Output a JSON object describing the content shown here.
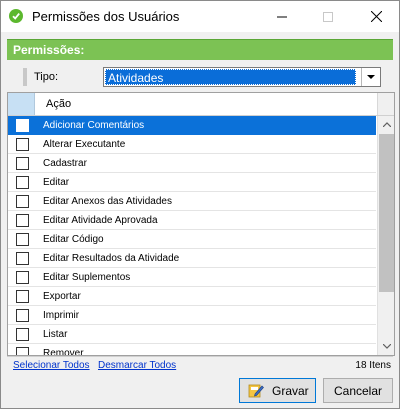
{
  "window": {
    "title": "Permissões dos Usuários",
    "icon": "app-check-icon"
  },
  "panel": {
    "header": "Permissões:"
  },
  "tipo": {
    "label": "Tipo:",
    "value": "Atividades"
  },
  "grid": {
    "column_header": "Ação",
    "rows": [
      {
        "label": "Adicionar Comentários",
        "checked": false,
        "selected": true
      },
      {
        "label": "Alterar Executante",
        "checked": false,
        "selected": false
      },
      {
        "label": "Cadastrar",
        "checked": false,
        "selected": false
      },
      {
        "label": "Editar",
        "checked": false,
        "selected": false
      },
      {
        "label": "Editar Anexos das Atividades",
        "checked": false,
        "selected": false
      },
      {
        "label": "Editar Atividade Aprovada",
        "checked": false,
        "selected": false
      },
      {
        "label": "Editar Código",
        "checked": false,
        "selected": false
      },
      {
        "label": "Editar Resultados da Atividade",
        "checked": false,
        "selected": false
      },
      {
        "label": "Editar Suplementos",
        "checked": false,
        "selected": false
      },
      {
        "label": "Exportar",
        "checked": false,
        "selected": false
      },
      {
        "label": "Imprimir",
        "checked": false,
        "selected": false
      },
      {
        "label": "Listar",
        "checked": false,
        "selected": false
      },
      {
        "label": "Remover",
        "checked": false,
        "selected": false
      }
    ]
  },
  "footer": {
    "select_all": "Selecionar Todos",
    "deselect_all": "Desmarcar Todos",
    "count": "18 Itens"
  },
  "buttons": {
    "save": "Gravar",
    "cancel": "Cancelar"
  },
  "colors": {
    "accent_green": "#7cc254",
    "selection_blue": "#0b71d9",
    "link_blue": "#0033cc"
  }
}
